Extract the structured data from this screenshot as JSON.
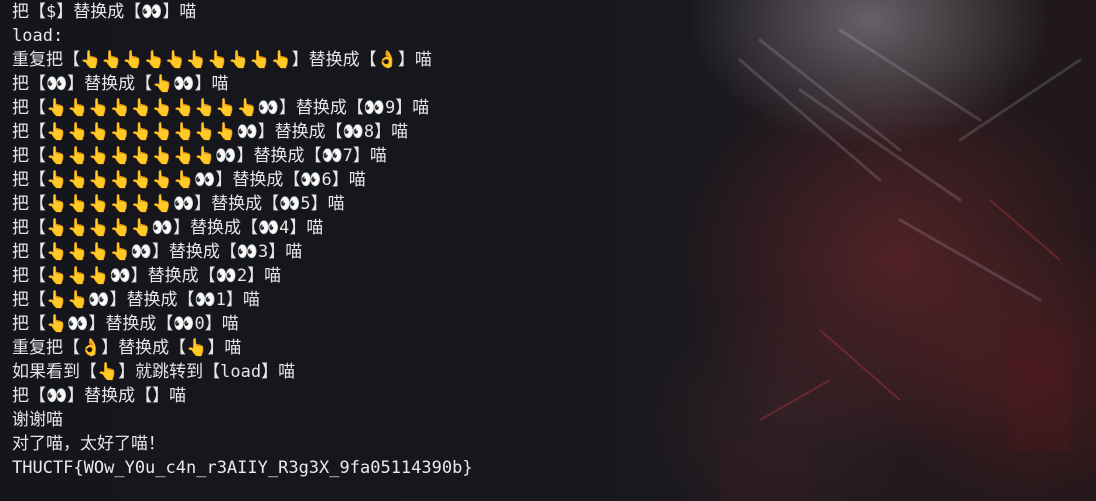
{
  "terminal": {
    "lines": [
      "把【$】替换成【👀】喵",
      "load:",
      "重复把【👆👆👆👆👆👆👆👆👆👆】替换成【👌】喵",
      "把【👀】替换成【👆👀】喵",
      "把【👆👆👆👆👆👆👆👆👆👆👀】替换成【👀9】喵",
      "把【👆👆👆👆👆👆👆👆👆👀】替换成【👀8】喵",
      "把【👆👆👆👆👆👆👆👆👀】替换成【👀7】喵",
      "把【👆👆👆👆👆👆👆👀】替换成【👀6】喵",
      "把【👆👆👆👆👆👆👀】替换成【👀5】喵",
      "把【👆👆👆👆👆👀】替换成【👀4】喵",
      "把【👆👆👆👆👀】替换成【👀3】喵",
      "把【👆👆👆👀】替换成【👀2】喵",
      "把【👆👆👀】替换成【👀1】喵",
      "把【👆👀】替换成【👀0】喵",
      "重复把【👌】替换成【👆】喵",
      "如果看到【👆】就跳转到【load】喵",
      "把【👀】替换成【】喵",
      "谢谢喵",
      "对了喵，太好了喵！",
      "THUCTF{WOw_Y0u_c4n_r3AIIY_R3g3X_9fa05114390b}"
    ]
  }
}
